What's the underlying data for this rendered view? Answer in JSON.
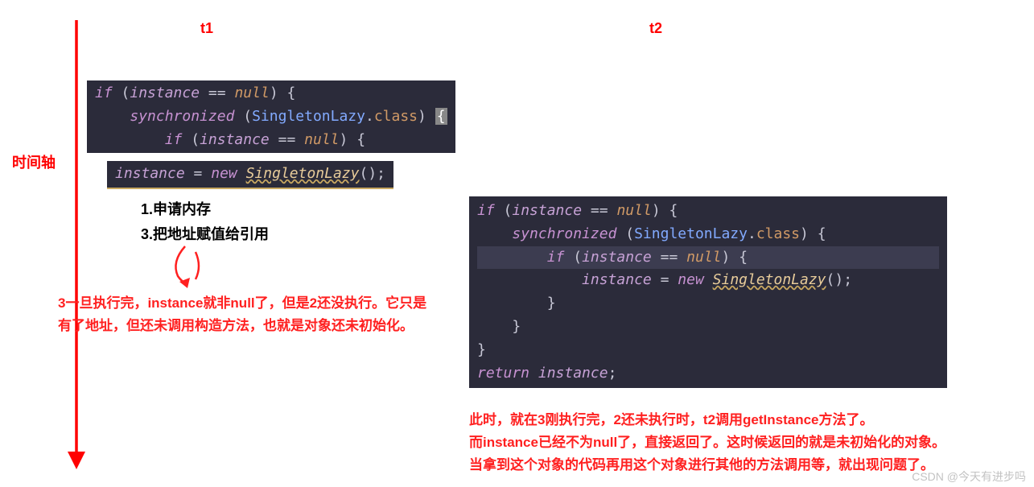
{
  "labels": {
    "timeAxis": "时间轴",
    "t1": "t1",
    "t2": "t2"
  },
  "code": {
    "t1_line1": "if (instance == null) {",
    "t1_line2": "    synchronized (SingletonLazy.class) {",
    "t1_line3": "        if (instance == null) {",
    "t1_assign": "instance = new SingletonLazy();",
    "t2_line1": "if (instance == null) {",
    "t2_line2": "    synchronized (SingletonLazy.class) {",
    "t2_line3": "        if (instance == null) {",
    "t2_line4": "            instance = new SingletonLazy();",
    "t2_line5": "        }",
    "t2_line6": "    }",
    "t2_line7": "}",
    "t2_line8": "return instance;"
  },
  "steps": {
    "step1": "1.申请内存",
    "step3": "3.把地址赋值给引用"
  },
  "notes": {
    "t1": "3一旦执行完，instance就非null了，但是2还没执行。它只是\n有了地址，但还未调用构造方法，也就是对象还未初始化。",
    "t2": "此时，就在3刚执行完，2还未执行时，t2调用getInstance方法了。\n而instance已经不为null了，直接返回了。这时候返回的就是未初始化的对象。\n当拿到这个对象的代码再用这个对象进行其他的方法调用等，就出现问题了。"
  },
  "watermark": "CSDN @今天有进步吗"
}
